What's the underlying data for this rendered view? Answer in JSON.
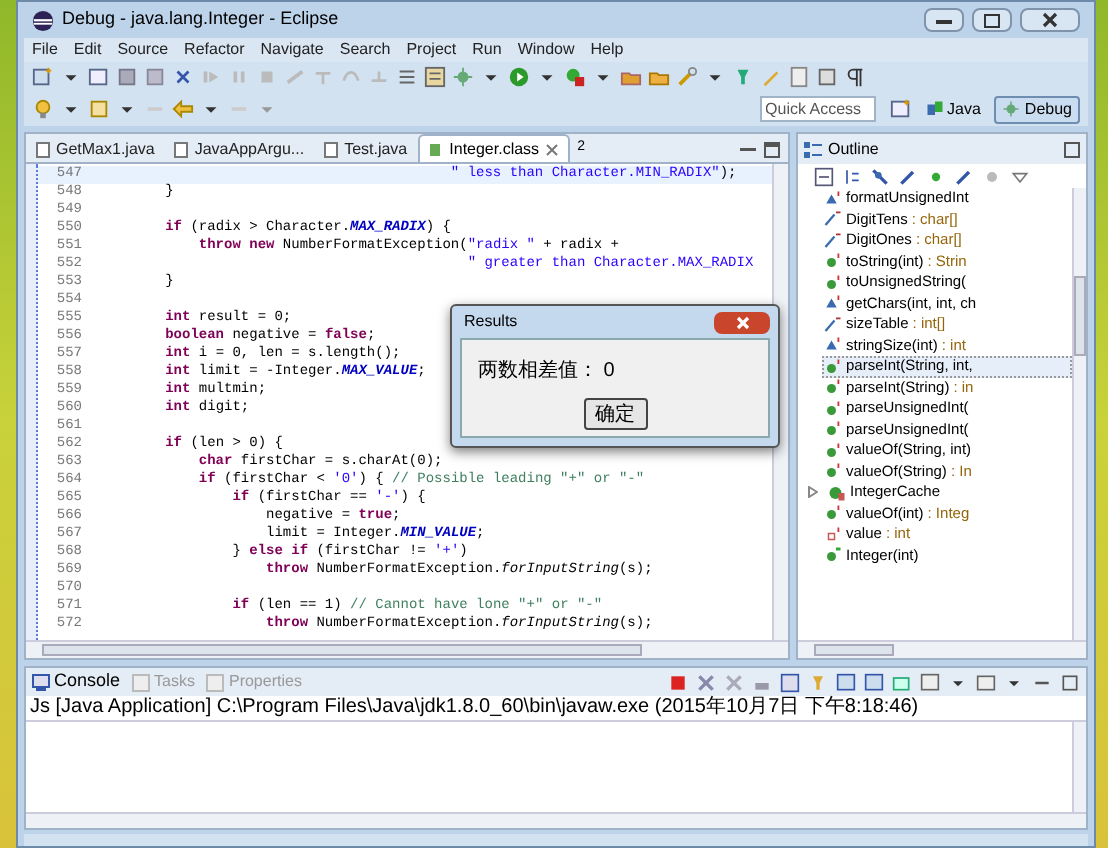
{
  "window": {
    "title": "Debug - java.lang.Integer - Eclipse"
  },
  "menu": [
    "File",
    "Edit",
    "Source",
    "Refactor",
    "Navigate",
    "Search",
    "Project",
    "Run",
    "Window",
    "Help"
  ],
  "quick_access": {
    "placeholder": "Quick Access"
  },
  "perspectives": [
    {
      "label": "Java",
      "selected": false
    },
    {
      "label": "Debug",
      "selected": true
    }
  ],
  "editor_tabs": [
    {
      "label": "GetMax1.java",
      "selected": false
    },
    {
      "label": "JavaAppArgu...",
      "selected": false
    },
    {
      "label": "Test.java",
      "selected": false
    },
    {
      "label": "Integer.class",
      "selected": true
    }
  ],
  "editor_overflow": "2",
  "code": [
    {
      "number": "547",
      "current": true,
      "segments": [
        {
          "text": "                                          \" less than Character.MIN_RADIX\"",
          "kind": "string"
        },
        {
          "text": ");",
          "kind": "plain"
        }
      ]
    },
    {
      "number": "548",
      "current": false,
      "segments": [
        {
          "text": "        }",
          "kind": "plain"
        }
      ]
    },
    {
      "number": "549",
      "current": false
    },
    {
      "number": "550",
      "current": false,
      "segments": [
        {
          "text": "        if",
          "kind": "keyword"
        },
        {
          "text": " (radix > Character.",
          "kind": "plain"
        },
        {
          "text": "MAX_RADIX",
          "kind": "constant"
        },
        {
          "text": ") {",
          "kind": "plain"
        }
      ]
    },
    {
      "number": "551",
      "current": false,
      "segments": [
        {
          "text": "            throw new",
          "kind": "keyword"
        },
        {
          "text": " NumberFormatException(",
          "kind": "plain"
        },
        {
          "text": "\"radix \"",
          "kind": "string"
        },
        {
          "text": " + radix +",
          "kind": "plain"
        }
      ]
    },
    {
      "number": "552",
      "current": false,
      "segments": [
        {
          "text": "                                            \" greater than Character.MAX_RADIX",
          "kind": "string"
        }
      ]
    },
    {
      "number": "553",
      "current": false,
      "segments": [
        {
          "text": "        }",
          "kind": "plain"
        }
      ]
    },
    {
      "number": "554",
      "current": false
    },
    {
      "number": "555",
      "current": false,
      "segments": [
        {
          "text": "        int",
          "kind": "keyword"
        },
        {
          "text": " result = 0;",
          "kind": "plain"
        }
      ]
    },
    {
      "number": "556",
      "current": false,
      "segments": [
        {
          "text": "        boolean",
          "kind": "keyword"
        },
        {
          "text": " negative = ",
          "kind": "plain"
        },
        {
          "text": "false",
          "kind": "keyword"
        },
        {
          "text": ";",
          "kind": "plain"
        }
      ]
    },
    {
      "number": "557",
      "current": false,
      "segments": [
        {
          "text": "        int",
          "kind": "keyword"
        },
        {
          "text": " i = 0, len = s.length();",
          "kind": "plain"
        }
      ]
    },
    {
      "number": "558",
      "current": false,
      "segments": [
        {
          "text": "        int",
          "kind": "keyword"
        },
        {
          "text": " limit = -Integer.",
          "kind": "plain"
        },
        {
          "text": "MAX_VALUE",
          "kind": "constant"
        },
        {
          "text": ";",
          "kind": "plain"
        }
      ]
    },
    {
      "number": "559",
      "current": false,
      "segments": [
        {
          "text": "        int",
          "kind": "keyword"
        },
        {
          "text": " multmin;",
          "kind": "plain"
        }
      ]
    },
    {
      "number": "560",
      "current": false,
      "segments": [
        {
          "text": "        int",
          "kind": "keyword"
        },
        {
          "text": " digit;",
          "kind": "plain"
        }
      ]
    },
    {
      "number": "561",
      "current": false
    },
    {
      "number": "562",
      "current": false,
      "segments": [
        {
          "text": "        if",
          "kind": "keyword"
        },
        {
          "text": " (len > 0) {",
          "kind": "plain"
        }
      ]
    },
    {
      "number": "563",
      "current": false,
      "segments": [
        {
          "text": "            char",
          "kind": "keyword"
        },
        {
          "text": " firstChar = s.charAt(0);",
          "kind": "plain"
        }
      ]
    },
    {
      "number": "564",
      "current": false,
      "segments": [
        {
          "text": "            if",
          "kind": "keyword"
        },
        {
          "text": " (firstChar < ",
          "kind": "plain"
        },
        {
          "text": "'0'",
          "kind": "string"
        },
        {
          "text": ") { ",
          "kind": "plain"
        },
        {
          "text": "// Possible leading \"+\" or \"-\"",
          "kind": "comment"
        }
      ]
    },
    {
      "number": "565",
      "current": false,
      "segments": [
        {
          "text": "                if",
          "kind": "keyword"
        },
        {
          "text": " (firstChar == ",
          "kind": "plain"
        },
        {
          "text": "'-'",
          "kind": "string"
        },
        {
          "text": ") {",
          "kind": "plain"
        }
      ]
    },
    {
      "number": "566",
      "current": false,
      "segments": [
        {
          "text": "                    negative = ",
          "kind": "plain"
        },
        {
          "text": "true",
          "kind": "keyword"
        },
        {
          "text": ";",
          "kind": "plain"
        }
      ]
    },
    {
      "number": "567",
      "current": false,
      "segments": [
        {
          "text": "                    limit = Integer.",
          "kind": "plain"
        },
        {
          "text": "MIN_VALUE",
          "kind": "constant"
        },
        {
          "text": ";",
          "kind": "plain"
        }
      ]
    },
    {
      "number": "568",
      "current": false,
      "segments": [
        {
          "text": "                } ",
          "kind": "plain"
        },
        {
          "text": "else if",
          "kind": "keyword"
        },
        {
          "text": " (firstChar != ",
          "kind": "plain"
        },
        {
          "text": "'+'",
          "kind": "string"
        },
        {
          "text": ")",
          "kind": "plain"
        }
      ]
    },
    {
      "number": "569",
      "current": false,
      "segments": [
        {
          "text": "                    throw",
          "kind": "keyword"
        },
        {
          "text": " NumberFormatException.",
          "kind": "plain"
        },
        {
          "text": "forInputString",
          "kind": "static"
        },
        {
          "text": "(s);",
          "kind": "plain"
        }
      ]
    },
    {
      "number": "570",
      "current": false
    },
    {
      "number": "571",
      "current": false,
      "segments": [
        {
          "text": "                if",
          "kind": "keyword"
        },
        {
          "text": " (len == 1) ",
          "kind": "plain"
        },
        {
          "text": "// Cannot have lone \"+\" or \"-\"",
          "kind": "comment"
        }
      ]
    },
    {
      "number": "572",
      "current": false,
      "segments": [
        {
          "text": "                    throw",
          "kind": "keyword"
        },
        {
          "text": " NumberFormatException.",
          "kind": "plain"
        },
        {
          "text": "forInputString",
          "kind": "static"
        },
        {
          "text": "(s);",
          "kind": "plain"
        }
      ]
    }
  ],
  "outline": {
    "title": "Outline",
    "items": [
      {
        "kind": "package-method",
        "name": "formatUnsignedInt",
        "selected": false
      },
      {
        "kind": "static-field",
        "name": "DigitTens",
        "type": " : char[]",
        "selected": false
      },
      {
        "kind": "static-field",
        "name": "DigitOnes",
        "type": " : char[]",
        "selected": false
      },
      {
        "kind": "method",
        "name": "toString(int)",
        "type": " : Strin",
        "selected": false
      },
      {
        "kind": "method",
        "name": "toUnsignedString(",
        "selected": false
      },
      {
        "kind": "package-method",
        "name": "getChars(int, int, ch",
        "selected": false
      },
      {
        "kind": "static-field",
        "name": "sizeTable",
        "type": " : int[]",
        "selected": false
      },
      {
        "kind": "package-method",
        "name": "stringSize(int)",
        "type": " : int",
        "selected": false
      },
      {
        "kind": "method",
        "name": "parseInt(String, int,",
        "selected": true
      },
      {
        "kind": "method",
        "name": "parseInt(String)",
        "type": " : in",
        "selected": false
      },
      {
        "kind": "method",
        "name": "parseUnsignedInt(",
        "selected": false
      },
      {
        "kind": "method",
        "name": "parseUnsignedInt(",
        "selected": false
      },
      {
        "kind": "method",
        "name": "valueOf(String, int)",
        "selected": false
      },
      {
        "kind": "method",
        "name": "valueOf(String)",
        "type": " : In",
        "selected": false
      },
      {
        "kind": "class",
        "name": "IntegerCache",
        "selected": false
      },
      {
        "kind": "method",
        "name": "valueOf(int)",
        "type": " : Integ",
        "selected": false
      },
      {
        "kind": "private-field",
        "name": "value",
        "type": " : int",
        "selected": false
      },
      {
        "kind": "constructor",
        "name": "Integer(int)",
        "selected": false
      }
    ]
  },
  "console": {
    "tabs": [
      {
        "label": "Console",
        "selected": true
      },
      {
        "label": "Tasks",
        "selected": false
      },
      {
        "label": "Properties",
        "selected": false
      }
    ],
    "header": "Js [Java Application] C:\\Program Files\\Java\\jdk1.8.0_60\\bin\\javaw.exe (2015年10月7日 下午8:18:46)"
  },
  "dialog": {
    "title": "Results",
    "message": "两数相差值： 0",
    "button": "确定"
  }
}
